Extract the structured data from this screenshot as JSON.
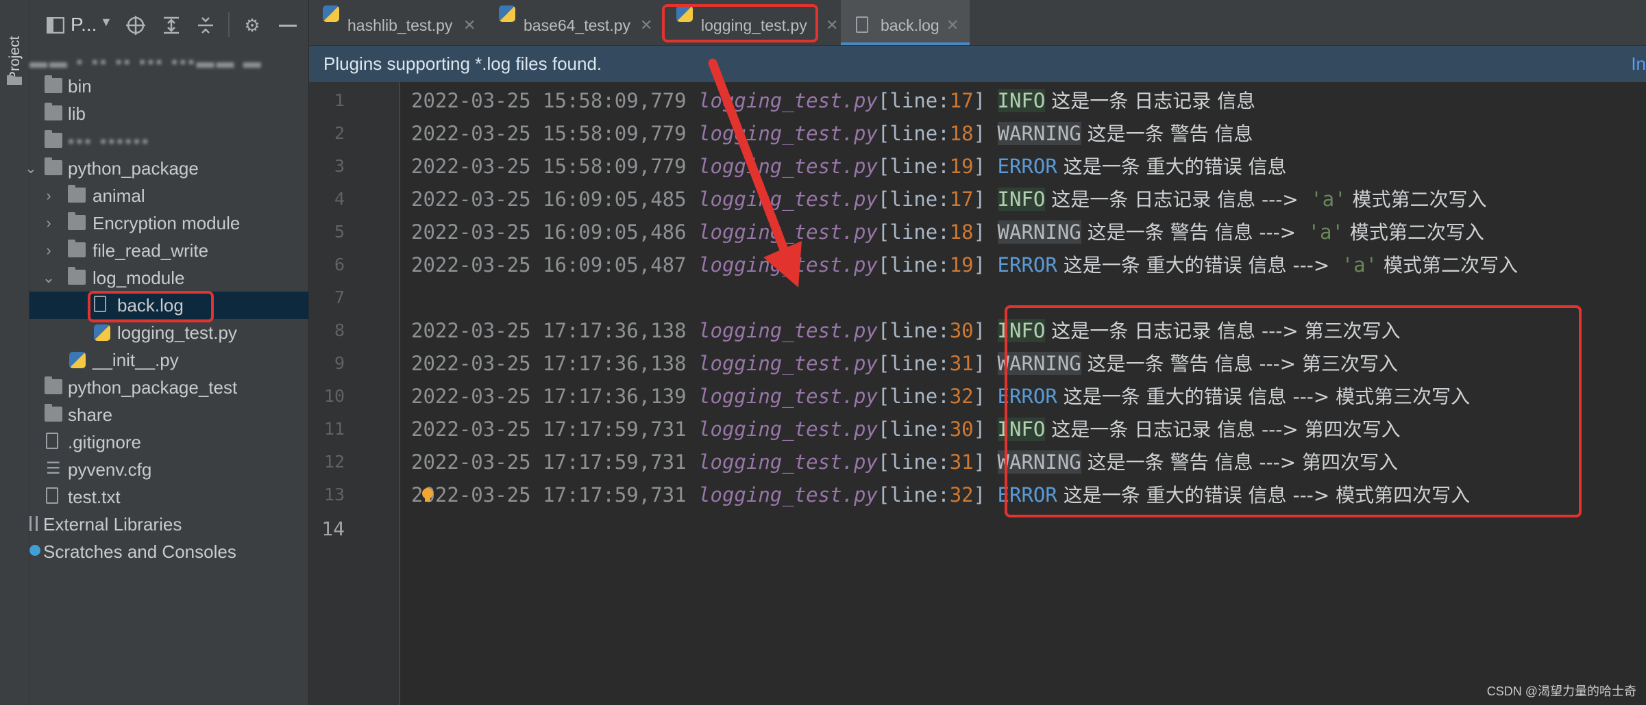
{
  "project_panel": {
    "title": "P...",
    "stripe_label": "Project",
    "tree": [
      {
        "label": "bin",
        "type": "folder"
      },
      {
        "label": "lib",
        "type": "folder"
      },
      {
        "label": "python_package",
        "type": "folder"
      },
      {
        "label": "animal",
        "type": "folder"
      },
      {
        "label": "Encryption module",
        "type": "folder"
      },
      {
        "label": "file_read_write",
        "type": "folder"
      },
      {
        "label": "log_module",
        "type": "folder"
      },
      {
        "label": "back.log",
        "type": "file"
      },
      {
        "label": "logging_test.py",
        "type": "python"
      },
      {
        "label": "__init__.py",
        "type": "python"
      },
      {
        "label": "python_package_test",
        "type": "folder"
      },
      {
        "label": "share",
        "type": "folder"
      },
      {
        "label": ".gitignore",
        "type": "file"
      },
      {
        "label": "pyvenv.cfg",
        "type": "file"
      },
      {
        "label": "test.txt",
        "type": "file"
      },
      {
        "label": "External Libraries",
        "type": "library"
      },
      {
        "label": "Scratches and Consoles",
        "type": "scratch"
      }
    ]
  },
  "tabs": [
    {
      "label": "hashlib_test.py",
      "icon": "python-file-icon"
    },
    {
      "label": "base64_test.py",
      "icon": "python-file-icon"
    },
    {
      "label": "logging_test.py",
      "icon": "python-file-icon"
    },
    {
      "label": "back.log",
      "icon": "log-file-icon",
      "active": true
    }
  ],
  "banner": {
    "text": "Plugins supporting *.log files found.",
    "link": "In"
  },
  "editor": {
    "line_numbers": [
      "1",
      "2",
      "3",
      "4",
      "5",
      "6",
      "7",
      "8",
      "9",
      "10",
      "11",
      "12",
      "13",
      "14"
    ],
    "current_line": "14",
    "lines": [
      {
        "ts": "2022-03-25 15:58:09,779",
        "file": "logging_test.py",
        "lineno": "17",
        "level": "INFO",
        "msg": "这是一条 日志记录 信息",
        "suffix": ""
      },
      {
        "ts": "2022-03-25 15:58:09,779",
        "file": "logging_test.py",
        "lineno": "18",
        "level": "WARNING",
        "msg": "这是一条 警告 信息",
        "suffix": ""
      },
      {
        "ts": "2022-03-25 15:58:09,779",
        "file": "logging_test.py",
        "lineno": "19",
        "level": "ERROR",
        "msg": "这是一条 重大的错误 信息",
        "suffix": ""
      },
      {
        "ts": "2022-03-25 16:09:05,485",
        "file": "logging_test.py",
        "lineno": "17",
        "level": "INFO",
        "msg": "这是一条 日志记录 信息 --->",
        "str": "'a'",
        "suffix": "模式第二次写入"
      },
      {
        "ts": "2022-03-25 16:09:05,486",
        "file": "logging_test.py",
        "lineno": "18",
        "level": "WARNING",
        "msg": "这是一条 警告 信息 --->",
        "str": "'a'",
        "suffix": "模式第二次写入"
      },
      {
        "ts": "2022-03-25 16:09:05,487",
        "file": "logging_test.py",
        "lineno": "19",
        "level": "ERROR",
        "msg": "这是一条 重大的错误 信息 --->",
        "str": "'a'",
        "suffix": "模式第二次写入"
      },
      {
        "empty": true
      },
      {
        "ts": "2022-03-25 17:17:36,138",
        "file": "logging_test.py",
        "lineno": "30",
        "level": "INFO",
        "msg": "这是一条 日志记录 信息 ---> 第三次写入",
        "suffix": ""
      },
      {
        "ts": "2022-03-25 17:17:36,138",
        "file": "logging_test.py",
        "lineno": "31",
        "level": "WARNING",
        "msg": "这是一条 警告 信息 ---> 第三次写入",
        "suffix": ""
      },
      {
        "ts": "2022-03-25 17:17:36,139",
        "file": "logging_test.py",
        "lineno": "32",
        "level": "ERROR",
        "msg": "这是一条 重大的错误 信息 ---> 模式第三次写入",
        "suffix": ""
      },
      {
        "ts": "2022-03-25 17:17:59,731",
        "file": "logging_test.py",
        "lineno": "30",
        "level": "INFO",
        "msg": "这是一条 日志记录 信息 ---> 第四次写入",
        "suffix": ""
      },
      {
        "ts": "2022-03-25 17:17:59,731",
        "file": "logging_test.py",
        "lineno": "31",
        "level": "WARNING",
        "msg": "这是一条 警告 信息 ---> 第四次写入",
        "suffix": ""
      },
      {
        "ts": "2022-03-25 17:17:59,731",
        "file": "logging_test.py",
        "lineno": "32",
        "level": "ERROR",
        "msg": "这是一条 重大的错误 信息 ---> 模式第四次写入",
        "suffix": ""
      }
    ]
  },
  "watermark": "CSDN @渴望力量的哈士奇",
  "colors": {
    "annotation_red": "#e2332f",
    "accent_blue": "#4a88c7",
    "banner_bg": "#344a5f"
  }
}
